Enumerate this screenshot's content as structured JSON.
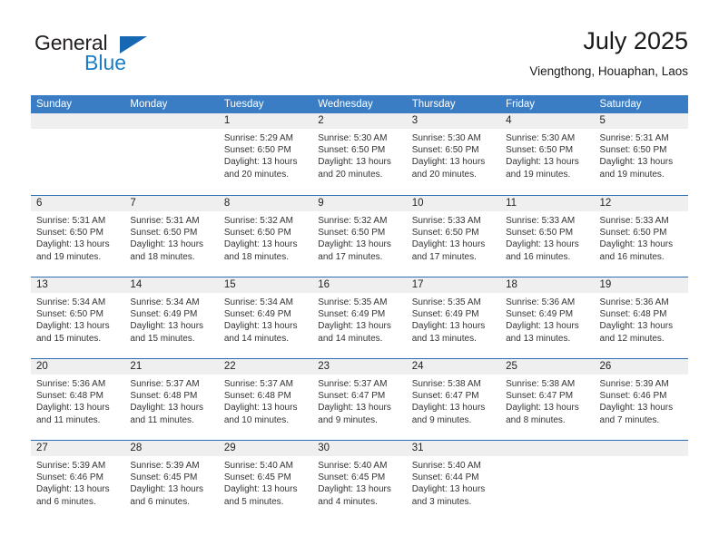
{
  "brand": {
    "name_top": "General",
    "name_bottom": "Blue",
    "accent_color": "#1b7dc4",
    "triangle_color": "#1668b3"
  },
  "header": {
    "title": "July 2025",
    "subtitle": "Viengthong, Houaphan, Laos"
  },
  "theme": {
    "header_row_color": "#3b7dc4",
    "week_divider_color": "#2e6db4",
    "day_band_color": "#efefef",
    "text_color": "#333333"
  },
  "weekdays": [
    "Sunday",
    "Monday",
    "Tuesday",
    "Wednesday",
    "Thursday",
    "Friday",
    "Saturday"
  ],
  "weeks": [
    [
      {
        "day": "",
        "sunrise": "",
        "sunset": "",
        "daylight_line1": "",
        "daylight_line2": ""
      },
      {
        "day": "",
        "sunrise": "",
        "sunset": "",
        "daylight_line1": "",
        "daylight_line2": ""
      },
      {
        "day": "1",
        "sunrise": "Sunrise: 5:29 AM",
        "sunset": "Sunset: 6:50 PM",
        "daylight_line1": "Daylight: 13 hours",
        "daylight_line2": "and 20 minutes."
      },
      {
        "day": "2",
        "sunrise": "Sunrise: 5:30 AM",
        "sunset": "Sunset: 6:50 PM",
        "daylight_line1": "Daylight: 13 hours",
        "daylight_line2": "and 20 minutes."
      },
      {
        "day": "3",
        "sunrise": "Sunrise: 5:30 AM",
        "sunset": "Sunset: 6:50 PM",
        "daylight_line1": "Daylight: 13 hours",
        "daylight_line2": "and 20 minutes."
      },
      {
        "day": "4",
        "sunrise": "Sunrise: 5:30 AM",
        "sunset": "Sunset: 6:50 PM",
        "daylight_line1": "Daylight: 13 hours",
        "daylight_line2": "and 19 minutes."
      },
      {
        "day": "5",
        "sunrise": "Sunrise: 5:31 AM",
        "sunset": "Sunset: 6:50 PM",
        "daylight_line1": "Daylight: 13 hours",
        "daylight_line2": "and 19 minutes."
      }
    ],
    [
      {
        "day": "6",
        "sunrise": "Sunrise: 5:31 AM",
        "sunset": "Sunset: 6:50 PM",
        "daylight_line1": "Daylight: 13 hours",
        "daylight_line2": "and 19 minutes."
      },
      {
        "day": "7",
        "sunrise": "Sunrise: 5:31 AM",
        "sunset": "Sunset: 6:50 PM",
        "daylight_line1": "Daylight: 13 hours",
        "daylight_line2": "and 18 minutes."
      },
      {
        "day": "8",
        "sunrise": "Sunrise: 5:32 AM",
        "sunset": "Sunset: 6:50 PM",
        "daylight_line1": "Daylight: 13 hours",
        "daylight_line2": "and 18 minutes."
      },
      {
        "day": "9",
        "sunrise": "Sunrise: 5:32 AM",
        "sunset": "Sunset: 6:50 PM",
        "daylight_line1": "Daylight: 13 hours",
        "daylight_line2": "and 17 minutes."
      },
      {
        "day": "10",
        "sunrise": "Sunrise: 5:33 AM",
        "sunset": "Sunset: 6:50 PM",
        "daylight_line1": "Daylight: 13 hours",
        "daylight_line2": "and 17 minutes."
      },
      {
        "day": "11",
        "sunrise": "Sunrise: 5:33 AM",
        "sunset": "Sunset: 6:50 PM",
        "daylight_line1": "Daylight: 13 hours",
        "daylight_line2": "and 16 minutes."
      },
      {
        "day": "12",
        "sunrise": "Sunrise: 5:33 AM",
        "sunset": "Sunset: 6:50 PM",
        "daylight_line1": "Daylight: 13 hours",
        "daylight_line2": "and 16 minutes."
      }
    ],
    [
      {
        "day": "13",
        "sunrise": "Sunrise: 5:34 AM",
        "sunset": "Sunset: 6:50 PM",
        "daylight_line1": "Daylight: 13 hours",
        "daylight_line2": "and 15 minutes."
      },
      {
        "day": "14",
        "sunrise": "Sunrise: 5:34 AM",
        "sunset": "Sunset: 6:49 PM",
        "daylight_line1": "Daylight: 13 hours",
        "daylight_line2": "and 15 minutes."
      },
      {
        "day": "15",
        "sunrise": "Sunrise: 5:34 AM",
        "sunset": "Sunset: 6:49 PM",
        "daylight_line1": "Daylight: 13 hours",
        "daylight_line2": "and 14 minutes."
      },
      {
        "day": "16",
        "sunrise": "Sunrise: 5:35 AM",
        "sunset": "Sunset: 6:49 PM",
        "daylight_line1": "Daylight: 13 hours",
        "daylight_line2": "and 14 minutes."
      },
      {
        "day": "17",
        "sunrise": "Sunrise: 5:35 AM",
        "sunset": "Sunset: 6:49 PM",
        "daylight_line1": "Daylight: 13 hours",
        "daylight_line2": "and 13 minutes."
      },
      {
        "day": "18",
        "sunrise": "Sunrise: 5:36 AM",
        "sunset": "Sunset: 6:49 PM",
        "daylight_line1": "Daylight: 13 hours",
        "daylight_line2": "and 13 minutes."
      },
      {
        "day": "19",
        "sunrise": "Sunrise: 5:36 AM",
        "sunset": "Sunset: 6:48 PM",
        "daylight_line1": "Daylight: 13 hours",
        "daylight_line2": "and 12 minutes."
      }
    ],
    [
      {
        "day": "20",
        "sunrise": "Sunrise: 5:36 AM",
        "sunset": "Sunset: 6:48 PM",
        "daylight_line1": "Daylight: 13 hours",
        "daylight_line2": "and 11 minutes."
      },
      {
        "day": "21",
        "sunrise": "Sunrise: 5:37 AM",
        "sunset": "Sunset: 6:48 PM",
        "daylight_line1": "Daylight: 13 hours",
        "daylight_line2": "and 11 minutes."
      },
      {
        "day": "22",
        "sunrise": "Sunrise: 5:37 AM",
        "sunset": "Sunset: 6:48 PM",
        "daylight_line1": "Daylight: 13 hours",
        "daylight_line2": "and 10 minutes."
      },
      {
        "day": "23",
        "sunrise": "Sunrise: 5:37 AM",
        "sunset": "Sunset: 6:47 PM",
        "daylight_line1": "Daylight: 13 hours",
        "daylight_line2": "and 9 minutes."
      },
      {
        "day": "24",
        "sunrise": "Sunrise: 5:38 AM",
        "sunset": "Sunset: 6:47 PM",
        "daylight_line1": "Daylight: 13 hours",
        "daylight_line2": "and 9 minutes."
      },
      {
        "day": "25",
        "sunrise": "Sunrise: 5:38 AM",
        "sunset": "Sunset: 6:47 PM",
        "daylight_line1": "Daylight: 13 hours",
        "daylight_line2": "and 8 minutes."
      },
      {
        "day": "26",
        "sunrise": "Sunrise: 5:39 AM",
        "sunset": "Sunset: 6:46 PM",
        "daylight_line1": "Daylight: 13 hours",
        "daylight_line2": "and 7 minutes."
      }
    ],
    [
      {
        "day": "27",
        "sunrise": "Sunrise: 5:39 AM",
        "sunset": "Sunset: 6:46 PM",
        "daylight_line1": "Daylight: 13 hours",
        "daylight_line2": "and 6 minutes."
      },
      {
        "day": "28",
        "sunrise": "Sunrise: 5:39 AM",
        "sunset": "Sunset: 6:45 PM",
        "daylight_line1": "Daylight: 13 hours",
        "daylight_line2": "and 6 minutes."
      },
      {
        "day": "29",
        "sunrise": "Sunrise: 5:40 AM",
        "sunset": "Sunset: 6:45 PM",
        "daylight_line1": "Daylight: 13 hours",
        "daylight_line2": "and 5 minutes."
      },
      {
        "day": "30",
        "sunrise": "Sunrise: 5:40 AM",
        "sunset": "Sunset: 6:45 PM",
        "daylight_line1": "Daylight: 13 hours",
        "daylight_line2": "and 4 minutes."
      },
      {
        "day": "31",
        "sunrise": "Sunrise: 5:40 AM",
        "sunset": "Sunset: 6:44 PM",
        "daylight_line1": "Daylight: 13 hours",
        "daylight_line2": "and 3 minutes."
      },
      {
        "day": "",
        "sunrise": "",
        "sunset": "",
        "daylight_line1": "",
        "daylight_line2": ""
      },
      {
        "day": "",
        "sunrise": "",
        "sunset": "",
        "daylight_line1": "",
        "daylight_line2": ""
      }
    ]
  ]
}
